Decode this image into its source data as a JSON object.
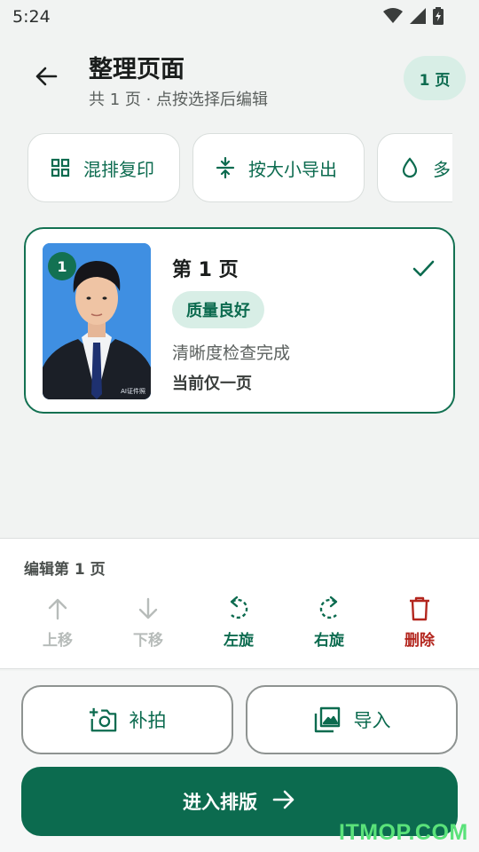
{
  "status_bar": {
    "time": "5:24",
    "icons": [
      "wifi-icon",
      "signal-icon",
      "battery-icon"
    ]
  },
  "header": {
    "back_icon": "arrow-left-icon",
    "title": "整理页面",
    "subtitle": "共 1 页 · 点按选择后编辑",
    "page_count_chip": "1 页"
  },
  "tools": [
    {
      "label": "混排复印",
      "icon": "grid-icon"
    },
    {
      "label": "按大小导出",
      "icon": "compress-icon"
    },
    {
      "label": "多",
      "icon": "drop-icon"
    }
  ],
  "page_card": {
    "badge": "1",
    "title": "第 1 页",
    "quality_badge": "质量良好",
    "clarity_text": "清晰度检查完成",
    "only_text": "当前仅一页",
    "thumb_watermark": "AI证件照",
    "check_icon": "check-icon"
  },
  "edit_panel": {
    "title": "编辑第 1 页",
    "actions": [
      {
        "label": "上移",
        "icon": "arrow-up-icon",
        "state": "disabled"
      },
      {
        "label": "下移",
        "icon": "arrow-down-icon",
        "state": "disabled"
      },
      {
        "label": "左旋",
        "icon": "rotate-left-icon",
        "state": "enabled"
      },
      {
        "label": "右旋",
        "icon": "rotate-right-icon",
        "state": "enabled"
      },
      {
        "label": "删除",
        "icon": "trash-icon",
        "state": "danger"
      }
    ]
  },
  "bottom": {
    "retake_label": "补拍",
    "import_label": "导入",
    "primary_label": "进入排版",
    "primary_icon": "arrow-right-icon"
  },
  "watermark": "ITMOP.COM",
  "colors": {
    "primary": "#0c6b4f",
    "chip_bg": "#d8eee6",
    "danger": "#b3261e",
    "disabled": "#b7bcba",
    "background": "#f1f3f2"
  }
}
